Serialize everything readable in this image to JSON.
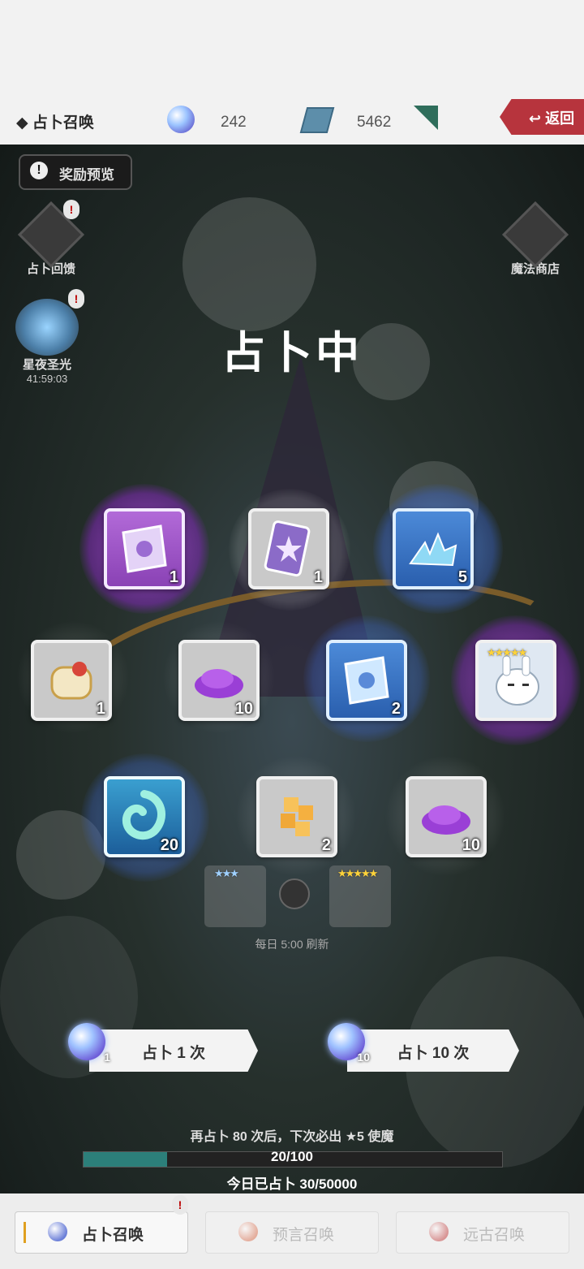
{
  "header": {
    "title": "◆ 占卜召唤",
    "crystal_ball_count": "242",
    "gem_count": "5462",
    "back_label": "返回"
  },
  "stage": {
    "reward_preview_label": "奖励预览",
    "reward_preview_icon": "!",
    "feedback_label": "占卜回馈",
    "starlight_label": "星夜圣光",
    "starlight_timer": "41:59:03",
    "magic_shop_label": "魔法商店",
    "badge_text": "!",
    "status_text": "占卜中"
  },
  "results": [
    {
      "name": "purple-scroll",
      "count": "1",
      "rarity": "purple"
    },
    {
      "name": "summon-card",
      "count": "1",
      "rarity": "gray"
    },
    {
      "name": "blue-crystal-shards",
      "count": "5",
      "rarity": "blue"
    },
    {
      "name": "gold-scroll",
      "count": "1",
      "rarity": "gray"
    },
    {
      "name": "purple-powder",
      "count": "10",
      "rarity": "gray"
    },
    {
      "name": "blue-scroll",
      "count": "2",
      "rarity": "blue"
    },
    {
      "name": "white-rabbit-character",
      "count": "",
      "rarity": "purple",
      "stars": "★★★★★"
    },
    {
      "name": "teal-spirit",
      "count": "20",
      "rarity": "teal"
    },
    {
      "name": "golden-blocks",
      "count": "2",
      "rarity": "gray"
    },
    {
      "name": "purple-powder",
      "count": "10",
      "rarity": "gray"
    }
  ],
  "featured": {
    "left_stars": "★★★",
    "right_stars": "★★★★★",
    "refresh_text": "每日 5:00 刷新"
  },
  "actions": {
    "single_label": "占卜 1 次",
    "single_cost": "1",
    "ten_label": "占卜 10 次",
    "ten_cost": "10"
  },
  "progress": {
    "pity_text": "再占卜 80 次后，下次必出 ★5 使魔",
    "current": 20,
    "max": 100,
    "label": "20/100",
    "today_text": "今日已占卜 30/50000"
  },
  "tabs": [
    {
      "label": "占卜召唤",
      "active": true,
      "color": "#6b7fd8"
    },
    {
      "label": "预言召唤",
      "active": false,
      "color": "#d86b4a"
    },
    {
      "label": "远古召唤",
      "active": false,
      "color": "#c03a3a"
    }
  ],
  "tab_badge": "!"
}
